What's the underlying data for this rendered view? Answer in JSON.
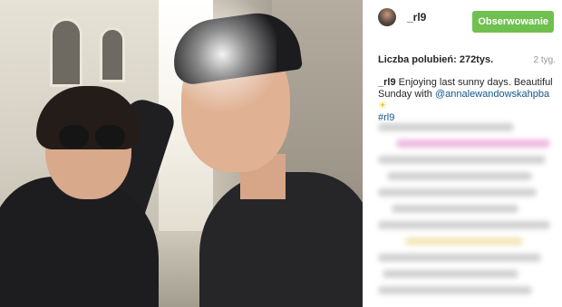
{
  "post": {
    "header": {
      "username": "_rl9",
      "follow_label": "Obserwowanie"
    },
    "likes": "Liczba polubień: 272tys.",
    "time_ago": "2 tyg.",
    "caption": {
      "author": "_rl9",
      "text_before": " Enjoying last sunny days. Beautiful Sunday with ",
      "mention": "@annalewandowskahpba",
      "emoji": "☀",
      "hashtag": "#rl9"
    },
    "colors": {
      "follow_button": "#70c050",
      "link": "#125688",
      "comment_tint_pink": "#e9a8d6",
      "comment_tint_yellow": "#efe2a8"
    },
    "icons": {
      "avatar": "avatar-icon",
      "sun": "sun-icon"
    }
  }
}
